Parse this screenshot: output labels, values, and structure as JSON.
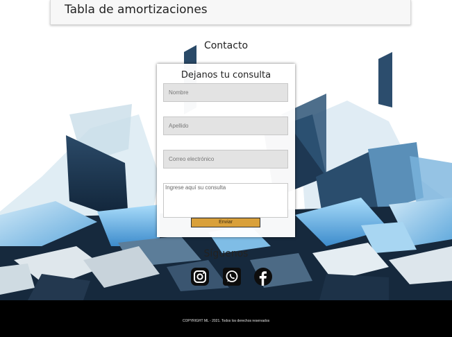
{
  "top_section": {
    "title": "Tabla de amortizaciones"
  },
  "contact": {
    "title": "Contacto",
    "form": {
      "heading": "Dejanos tu consulta",
      "name_placeholder": "Nombre",
      "lastname_placeholder": "Apellido",
      "email_placeholder": "Correo electrónico",
      "message_placeholder": "Ingrese aquí su consulta",
      "submit_label": "Enviar"
    }
  },
  "social": {
    "title": "Síguenos",
    "icons": [
      "instagram-icon",
      "whatsapp-icon",
      "facebook-icon"
    ]
  },
  "footer": {
    "copyright": "COPYRIGHT ML - 2021. Todos los derechos reservados"
  },
  "colors": {
    "accent": "#d9a03a",
    "footer_bg": "#000000",
    "field_bg": "#e3e3e3",
    "art_dark": "#1f3b58",
    "art_light": "#8fc6ea"
  }
}
